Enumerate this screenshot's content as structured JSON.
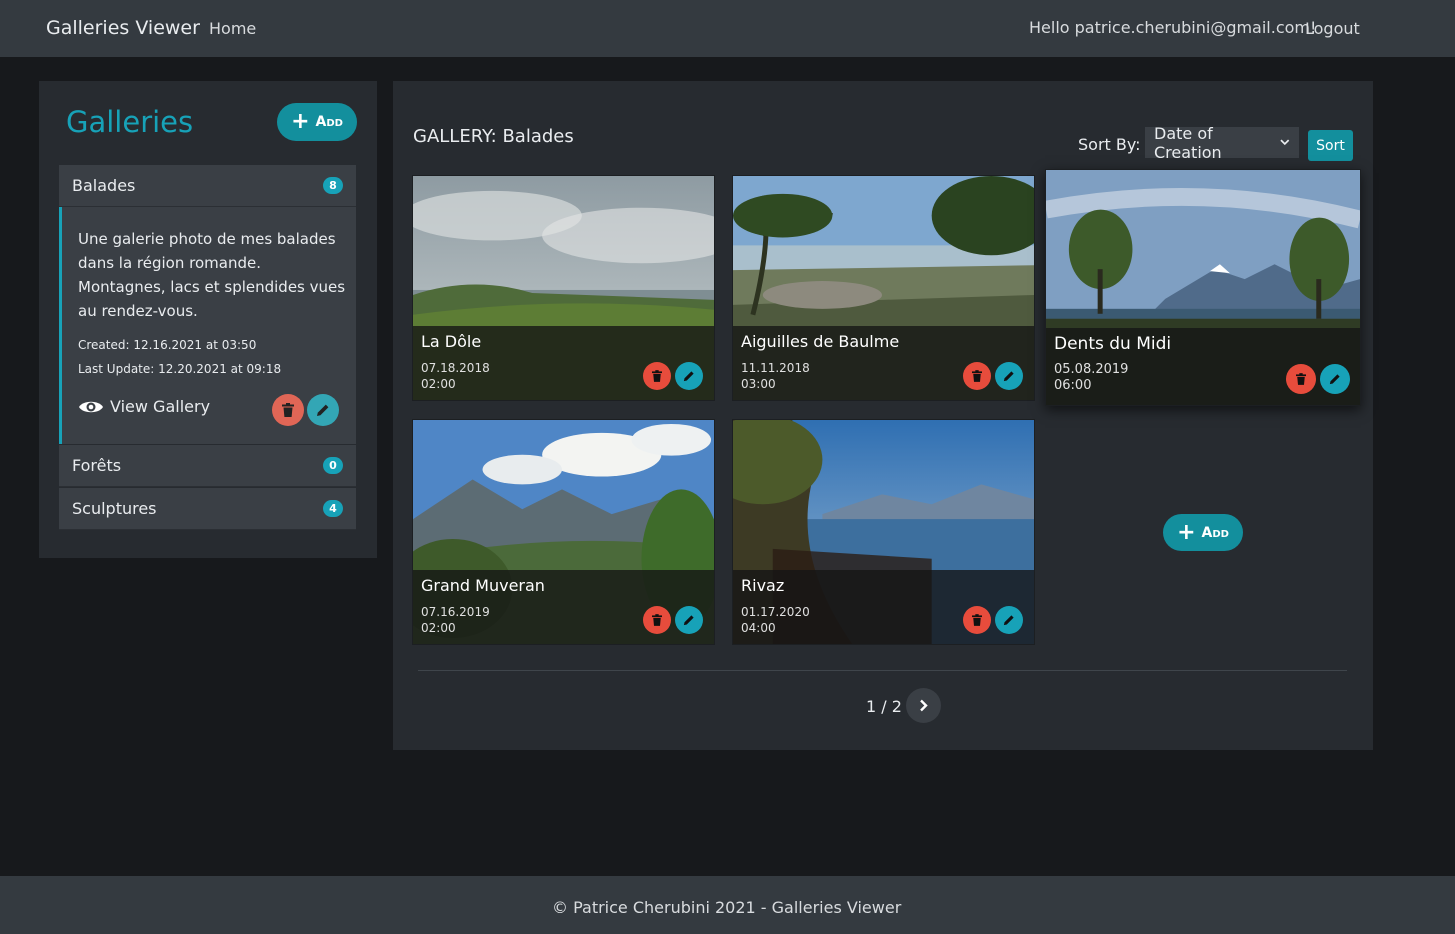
{
  "navbar": {
    "brand": "Galleries Viewer",
    "home": "Home",
    "hello": "Hello patrice.cherubini@gmail.com!",
    "logout": "Logout"
  },
  "sidebar": {
    "title": "Galleries",
    "add_label": "Add",
    "items": [
      {
        "name": "Balades",
        "count": "8",
        "description": "Une galerie photo de mes balades dans la région romande. Montagnes, lacs et splendides vues au rendez-vous.",
        "created": "Created: 12.16.2021 at 03:50",
        "updated": "Last Update: 12.20.2021 at 09:18",
        "view_label": "View Gallery"
      },
      {
        "name": "Forêts",
        "count": "0"
      },
      {
        "name": "Sculptures",
        "count": "4"
      }
    ]
  },
  "main": {
    "title": "GALLERY: Balades",
    "sort_label": "Sort By:",
    "sort_value": "Date of Creation",
    "sort_button": "Sort",
    "add_label": "Add",
    "pager": "1 / 2",
    "next_icon": "chevron-right-icon",
    "cards": [
      {
        "title": "La Dôle",
        "date": "07.18.2018",
        "time": "02:00"
      },
      {
        "title": "Aiguilles de Baulme",
        "date": "11.11.2018",
        "time": "03:00"
      },
      {
        "title": "Dents du Midi",
        "date": "05.08.2019",
        "time": "06:00"
      },
      {
        "title": "Grand Muveran",
        "date": "07.16.2019",
        "time": "02:00"
      },
      {
        "title": "Rivaz",
        "date": "01.17.2020",
        "time": "04:00"
      }
    ]
  },
  "footer": {
    "text": "© Patrice Cherubini 2021 - Galleries Viewer"
  },
  "colors": {
    "accent": "#17a2b8",
    "danger": "#e74c3c",
    "navbar": "#343a40",
    "panel": "#272b30",
    "background": "#17191c"
  }
}
